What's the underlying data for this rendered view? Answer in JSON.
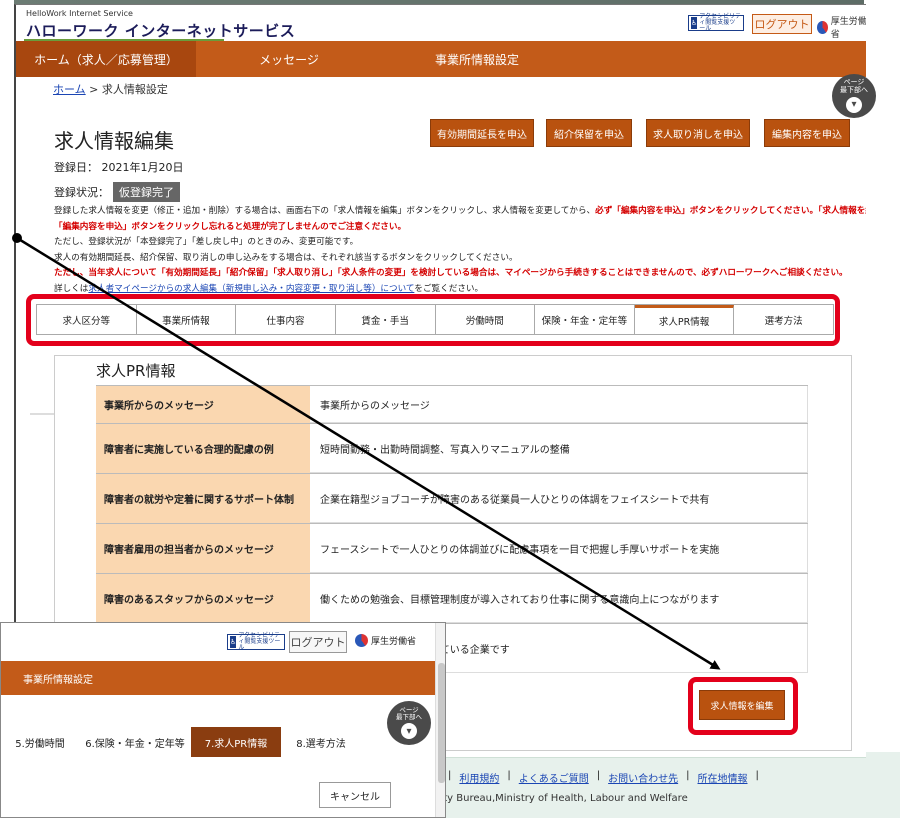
{
  "header": {
    "logo_small": "HelloWork Internet Service",
    "logo_big": "ハローワーク インターネットサービス",
    "accessibility_badge": "アクセシビリティ閲覧支援ツール",
    "logout_label": "ログアウト",
    "ministry_label": "厚生労働省"
  },
  "nav": {
    "items": [
      "ホーム（求人／応募管理）",
      "メッセージ",
      "事業所情報設定"
    ]
  },
  "breadcrumb": {
    "home": "ホーム",
    "current": "求人情報設定"
  },
  "page_top": {
    "label1": "ページ",
    "label2": "最下部へ"
  },
  "page": {
    "title": "求人情報編集",
    "reg_date": "登録日： 2021年1月20日",
    "reg_status_label": "登録状況：",
    "reg_status_value": "仮登録完了"
  },
  "action_buttons": [
    "有効期間延長を申込",
    "紹介保留を申込",
    "求人取り消しを申込",
    "編集内容を申込"
  ],
  "notes": {
    "l1a": "登録した求人情報を変更（修正・追加・削除）する場合は、画面右下の「求人情報を編集」ボタンをクリックし、求人情報を変更してから、",
    "l1b": "必ず「編集内容を申込」ボタンをクリックしてください。「求人情報を編集」後、",
    "l2": "「編集内容を申込」ボタンをクリックし忘れると処理が完了しませんのでご注意ください。",
    "l3": "ただし、登録状況が「本登録完了」「差し戻し中」のときのみ、変更可能です。",
    "l4": "求人の有効期間延長、紹介保留、取り消しの申し込みをする場合は、それぞれ該当するボタンをクリックしてください。",
    "l5": "ただし、当年求人について「有効期間延長」「紹介保留」「求人取り消し」「求人条件の変更」を検討している場合は、マイページから手続きすることはできませんので、必ずハローワークへご相談ください。",
    "l6a": "詳しくは",
    "l6link": "求人者マイページからの求人編集（新規申し込み・内容変更・取り消し等）について",
    "l6b": "をご覧ください。"
  },
  "tabs": [
    "求人区分等",
    "事業所情報",
    "仕事内容",
    "賃金・手当",
    "労働時間",
    "保険・年金・定年等",
    "求人PR情報",
    "選考方法"
  ],
  "active_tab": 6,
  "pr": {
    "title": "求人PR情報",
    "rows": [
      {
        "label": "事業所からのメッセージ",
        "value": "事業所からのメッセージ"
      },
      {
        "label": "障害者に実施している合理的配慮の例",
        "value": "短時間勤務・出勤時間調整、写真入りマニュアルの整備"
      },
      {
        "label": "障害者の就労や定着に関するサポート体制",
        "value": "企業在籍型ジョブコーチが障害のある従業員一人ひとりの体調をフェイスシートで共有"
      },
      {
        "label": "障害者雇用の担当者からのメッセージ",
        "value": "フェースシートで一人ひとりの体調並びに配慮事項を一目で把握し手厚いサポートを実施"
      },
      {
        "label": "障害のあるスタッフからのメッセージ",
        "value": "働くための勉強会、目標管理制度が導入されており仕事に関する意識向上につながります"
      },
      {
        "label": "",
        "value": "び職場定着の促進に努力している企業です"
      }
    ]
  },
  "edit_button": "求人情報を編集",
  "footer": {
    "links": [
      "ー",
      "利用規約",
      "よくあるご質問",
      "お問い合わせ先",
      "所在地情報"
    ],
    "copyright": "urity Bureau,Ministry of Health, Labour and Welfare"
  },
  "inset": {
    "accessibility_badge": "アクセシビリティ閲覧支援ツール",
    "logout_label": "ログアウト",
    "ministry_label": "厚生労働省",
    "nav_label": "事業所情報設定",
    "page_top1": "ページ",
    "page_top2": "最下部へ",
    "steps": [
      "5.労働時間",
      "6.保険・年金・定年等",
      "7.求人PR情報",
      "8.選考方法"
    ],
    "active_step": 2,
    "cancel_label": "キャンセル"
  },
  "colors": {
    "brand_orange": "#c35b19",
    "highlight_red": "#e3001b",
    "pr_header_bg": "#fad7b0",
    "footer_bg": "#e7f1ec"
  }
}
